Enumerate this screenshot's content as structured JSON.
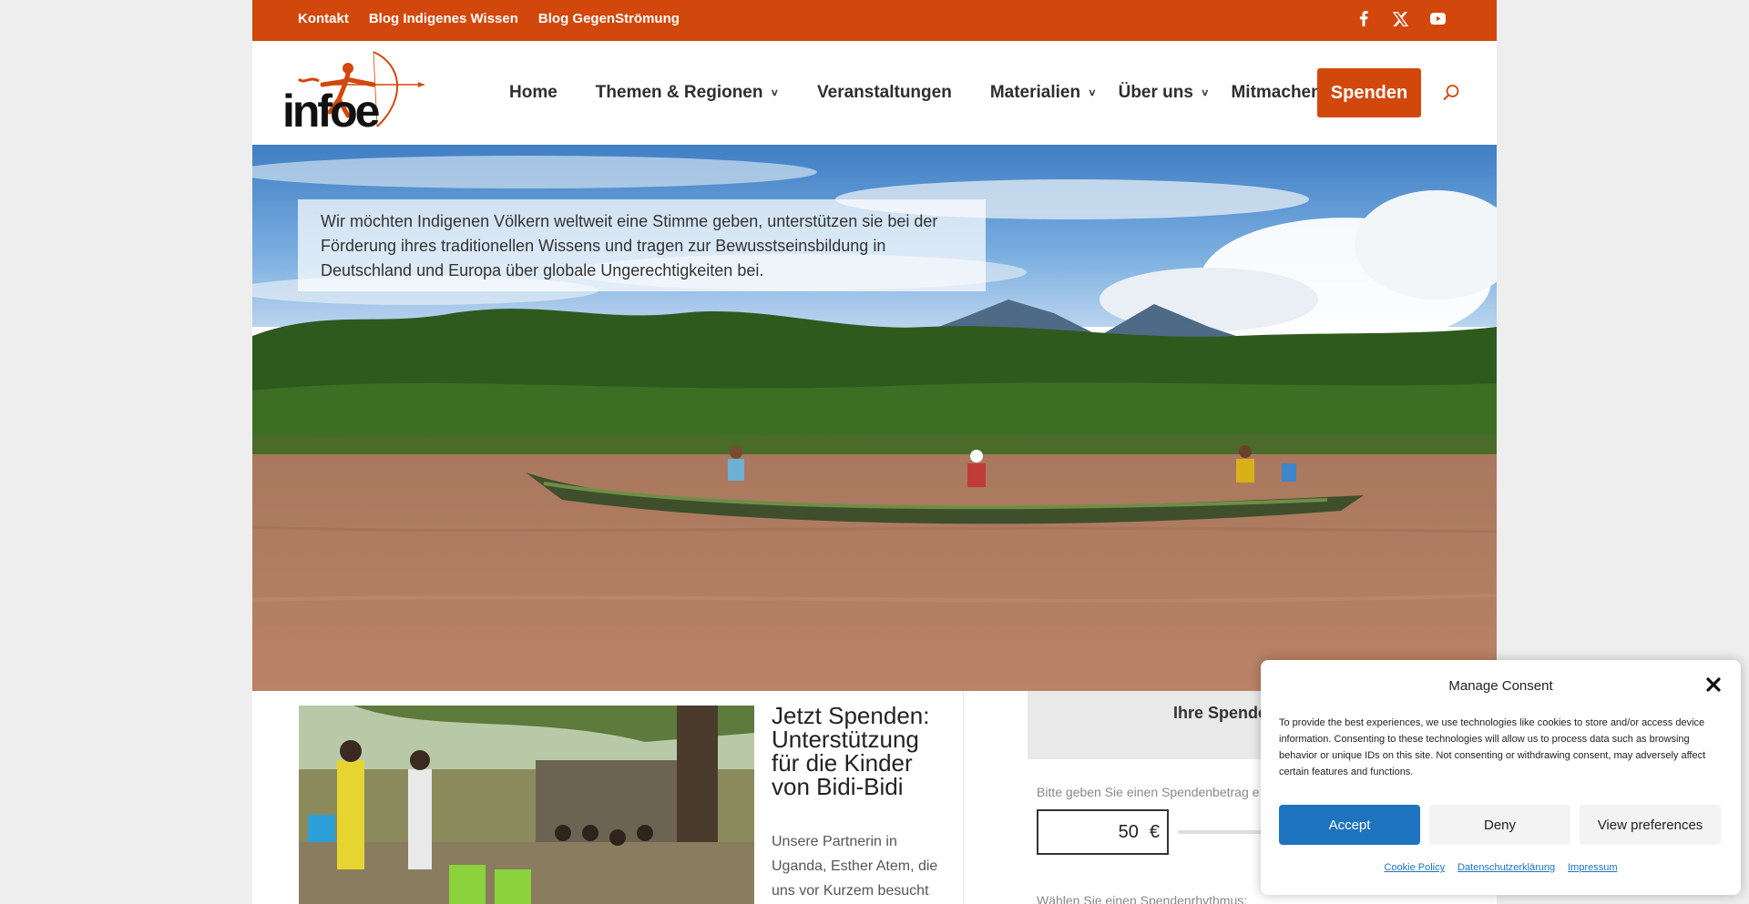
{
  "topbar": {
    "links": [
      "Kontakt",
      "Blog Indigenes Wissen",
      "Blog GegenStrömung"
    ],
    "social_icons": [
      "facebook-icon",
      "x-icon",
      "youtube-icon"
    ],
    "color": "#d2470b"
  },
  "header": {
    "logo_text": "infoe",
    "nav": [
      {
        "label": "Home",
        "dropdown": false
      },
      {
        "label": "Themen & Regionen",
        "dropdown": true
      },
      {
        "label": "Veranstaltungen",
        "dropdown": false
      },
      {
        "label": "Materialien",
        "dropdown": true
      },
      {
        "label": "Über uns",
        "dropdown": true
      },
      {
        "label": "Mitmachen",
        "dropdown": true
      }
    ],
    "cta_label": "Spenden",
    "search_icon": "search-icon"
  },
  "hero": {
    "text": "Wir möchten Indigenen Völkern weltweit eine Stimme geben, unterstützen sie bei der Förderung ihres traditionellen Wissens und tragen zur Bewusstseinsbildung in Deutschland und Europa über globale Ungerechtigkeiten bei."
  },
  "card": {
    "title": "Jetzt Spenden: Unterstützung für die Kinder von Bidi-Bidi",
    "text": "Unsere Partnerin in Uganda, Esther Atem, die uns vor Kurzem besucht hat, arbeitet"
  },
  "donation": {
    "heading": "Ihre Spende",
    "amount_hint": "Bitte geben Sie einen Spendenbetrag e",
    "amount_value": "50",
    "currency": "€",
    "rhythm_hint": "Wählen Sie einen Spendenrhythmus:"
  },
  "consent": {
    "title": "Manage Consent",
    "text": "To provide the best experiences, we use technologies like cookies to store and/or access device information. Consenting to these technologies will allow us to process data such as browsing behavior or unique IDs on this site. Not consenting or withdrawing consent, may adversely affect certain features and functions.",
    "accept_label": "Accept",
    "deny_label": "Deny",
    "prefs_label": "View preferences",
    "links": [
      "Cookie Policy",
      "Datenschutzerklärung",
      "Impressum"
    ],
    "accent": "#1e73be"
  }
}
